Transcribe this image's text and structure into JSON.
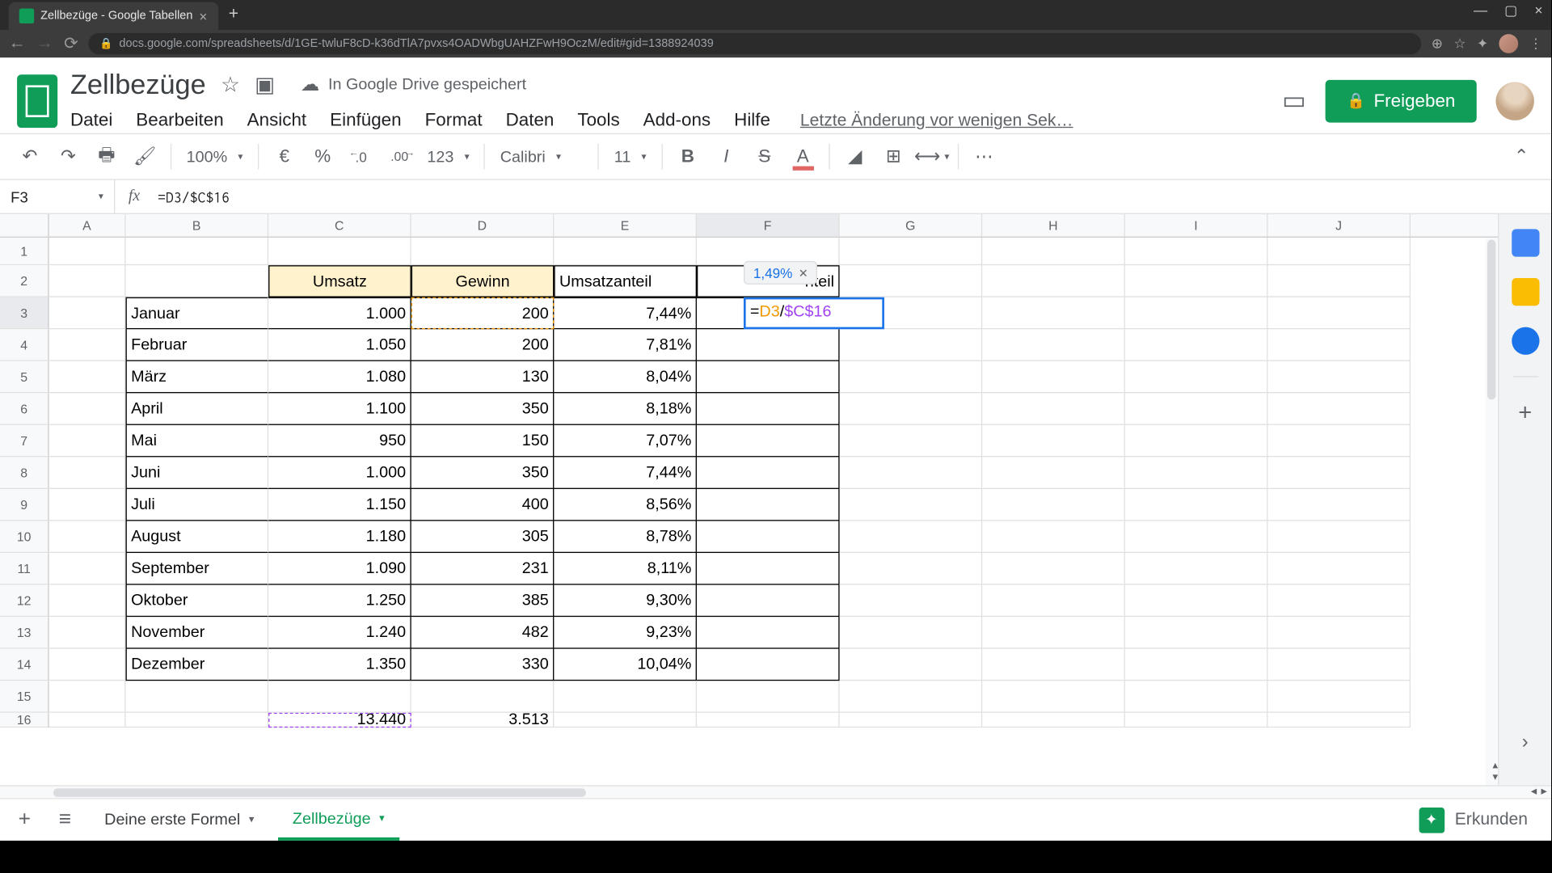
{
  "browser": {
    "tab_title": "Zellbezüge - Google Tabellen",
    "url": "docs.google.com/spreadsheets/d/1GE-twluF8cD-k36dTlA7pvxs4OADWbgUAHZFwH9OczM/edit#gid=1388924039"
  },
  "doc": {
    "title": "Zellbezüge",
    "drive_status": "In Google Drive gespeichert",
    "share_label": "Freigeben",
    "last_edit": "Letzte Änderung vor wenigen Sek…"
  },
  "menu": [
    "Datei",
    "Bearbeiten",
    "Ansicht",
    "Einfügen",
    "Format",
    "Daten",
    "Tools",
    "Add-ons",
    "Hilfe"
  ],
  "toolbar": {
    "zoom": "100%",
    "currency": "€",
    "percent": "%",
    "dec_dec": ".0",
    "inc_dec": ".00",
    "numfmt": "123",
    "font": "Calibri",
    "size": "11"
  },
  "namebox": "F3",
  "formula": "=D3/$C$16",
  "columns": [
    "A",
    "B",
    "C",
    "D",
    "E",
    "F",
    "G",
    "H",
    "I",
    "J"
  ],
  "headers": {
    "c": "Umsatz",
    "d": "Gewinn",
    "e": "Umsatzanteil",
    "f_suffix": "nteil"
  },
  "rows": [
    {
      "n": 1
    },
    {
      "n": 2
    },
    {
      "n": 3,
      "b": "Januar",
      "c": "1.000",
      "d": "200",
      "e": "7,44%"
    },
    {
      "n": 4,
      "b": "Februar",
      "c": "1.050",
      "d": "200",
      "e": "7,81%"
    },
    {
      "n": 5,
      "b": "März",
      "c": "1.080",
      "d": "130",
      "e": "8,04%"
    },
    {
      "n": 6,
      "b": "April",
      "c": "1.100",
      "d": "350",
      "e": "8,18%"
    },
    {
      "n": 7,
      "b": "Mai",
      "c": "950",
      "d": "150",
      "e": "7,07%"
    },
    {
      "n": 8,
      "b": "Juni",
      "c": "1.000",
      "d": "350",
      "e": "7,44%"
    },
    {
      "n": 9,
      "b": "Juli",
      "c": "1.150",
      "d": "400",
      "e": "8,56%"
    },
    {
      "n": 10,
      "b": "August",
      "c": "1.180",
      "d": "305",
      "e": "8,78%"
    },
    {
      "n": 11,
      "b": "September",
      "c": "1.090",
      "d": "231",
      "e": "8,11%"
    },
    {
      "n": 12,
      "b": "Oktober",
      "c": "1.250",
      "d": "385",
      "e": "9,30%"
    },
    {
      "n": 13,
      "b": "November",
      "c": "1.240",
      "d": "482",
      "e": "9,23%"
    },
    {
      "n": 14,
      "b": "Dezember",
      "c": "1.350",
      "d": "330",
      "e": "10,04%"
    },
    {
      "n": 15
    },
    {
      "n": 16,
      "c": "13.440",
      "d": "3.513"
    }
  ],
  "active_cell": {
    "preview": "1,49%",
    "formula_prefix": "=",
    "formula_d3": "D3",
    "formula_mid": "/",
    "formula_c16": "$C$16"
  },
  "sheets": {
    "tab1": "Deine erste Formel",
    "tab2": "Zellbezüge",
    "explore": "Erkunden"
  }
}
